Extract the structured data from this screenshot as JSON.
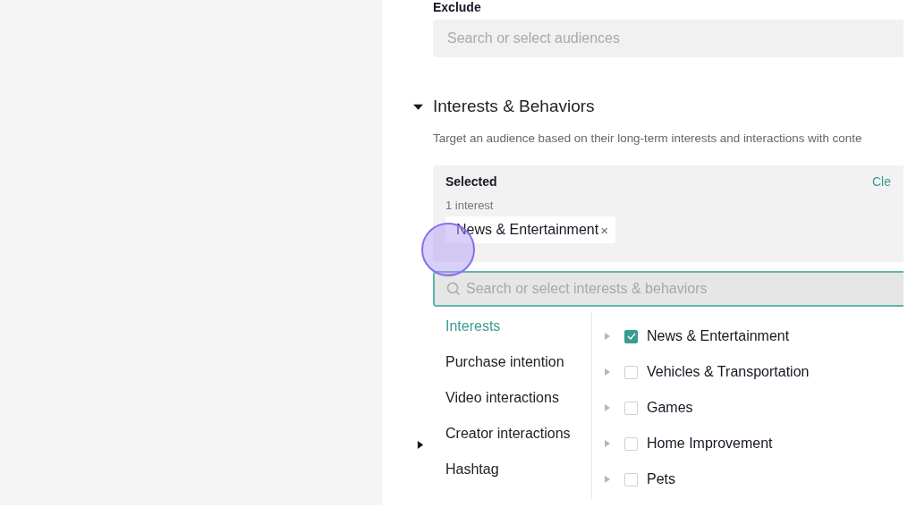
{
  "exclude": {
    "label": "Exclude",
    "placeholder": "Search or select audiences"
  },
  "section": {
    "title": "Interests & Behaviors",
    "expanded": true,
    "description": "Target an audience based on their long-term interests and interactions with conte"
  },
  "selected": {
    "title": "Selected",
    "count": "1 interest",
    "clear": "Cle",
    "tags": [
      {
        "label": "News & Entertainment",
        "remove": "×"
      }
    ]
  },
  "search": {
    "placeholder": "Search or select interests & behaviors"
  },
  "categories": [
    {
      "label": "Interests",
      "selected": true
    },
    {
      "label": "Purchase intention",
      "selected": false
    },
    {
      "label": "Video interactions",
      "selected": false
    },
    {
      "label": "Creator interactions",
      "selected": false
    },
    {
      "label": "Hashtag",
      "selected": false
    }
  ],
  "options": [
    {
      "label": "News & Entertainment",
      "checked": true
    },
    {
      "label": "Vehicles & Transportation",
      "checked": false
    },
    {
      "label": "Games",
      "checked": false
    },
    {
      "label": "Home Improvement",
      "checked": false
    },
    {
      "label": "Pets",
      "checked": false
    }
  ],
  "next_section": {
    "expanded": false
  }
}
